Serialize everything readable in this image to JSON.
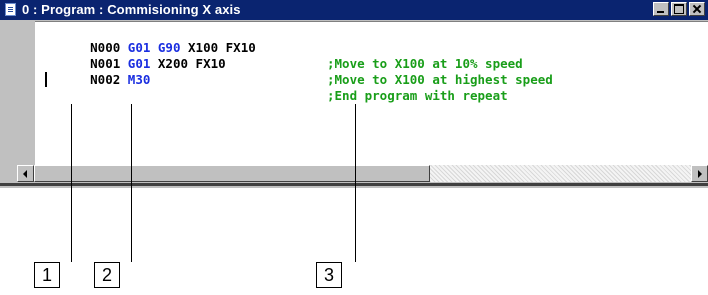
{
  "window": {
    "title": "0 : Program : Commisioning X axis",
    "buttons": {
      "minimize": "minimize",
      "maximize": "maximize",
      "close": "close"
    }
  },
  "program": {
    "lines": [
      {
        "block": "N000",
        "tokens": [
          {
            "text": "G01",
            "color": "#1a2ee0"
          },
          {
            "text": "G90",
            "color": "#1a2ee0"
          },
          {
            "text": "X100",
            "color": "#000000"
          },
          {
            "text": "FX10",
            "color": "#000000"
          }
        ],
        "comment": ";Move to X100 at 10% speed"
      },
      {
        "block": "N001",
        "tokens": [
          {
            "text": "G01",
            "color": "#1a2ee0"
          },
          {
            "text": "X200",
            "color": "#000000"
          },
          {
            "text": "FX10",
            "color": "#000000"
          }
        ],
        "comment": ";Move to X100 at highest speed"
      },
      {
        "block": "N002",
        "tokens": [
          {
            "text": "M30",
            "color": "#1a2ee0"
          }
        ],
        "comment": ";End program with repeat"
      }
    ],
    "colors": {
      "keyword": "#1a2ee0",
      "comment": "#199e19",
      "text": "#000000"
    }
  },
  "callouts": [
    {
      "label": "1"
    },
    {
      "label": "2"
    },
    {
      "label": "3"
    }
  ]
}
